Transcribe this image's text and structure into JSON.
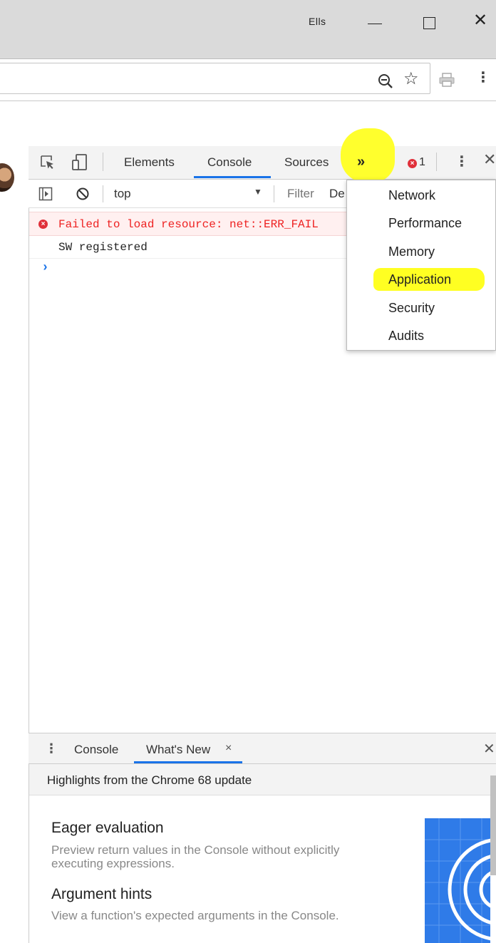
{
  "window": {
    "profile_name": "Ells",
    "minimize_icon": "minimize-icon",
    "maximize_icon": "maximize-icon",
    "close_icon": "close-icon"
  },
  "toolbar": {
    "zoom_icon": "zoom-out-icon",
    "bookmark_icon": "star-icon",
    "extension_icon": "printer-icon",
    "menu_icon": "kebab-menu-icon"
  },
  "devtools": {
    "tabs": [
      {
        "label": "Elements"
      },
      {
        "label": "Console",
        "active": true
      },
      {
        "label": "Sources"
      }
    ],
    "more_tabs_glyph": "»",
    "error_count": "1",
    "context": "top",
    "filter_placeholder": "Filter",
    "levels_label": "De",
    "overflow_menu": {
      "items": [
        {
          "label": "Network"
        },
        {
          "label": "Performance"
        },
        {
          "label": "Memory"
        },
        {
          "label": "Application",
          "highlighted": true
        },
        {
          "label": "Security"
        },
        {
          "label": "Audits"
        }
      ]
    },
    "messages": [
      {
        "level": "error",
        "text": "Failed to load resource: net::ERR_FAIL"
      },
      {
        "level": "log",
        "text": "SW registered"
      }
    ],
    "prompt_glyph": "›"
  },
  "drawer": {
    "tabs": [
      {
        "label": "Console"
      },
      {
        "label": "What's New",
        "active": true,
        "closable": true
      }
    ],
    "close_glyph": "×",
    "highlights_title": "Highlights from the Chrome 68 update",
    "features": [
      {
        "title": "Eager evaluation",
        "description": "Preview return values in the Console without explicitly executing expressions."
      },
      {
        "title": "Argument hints",
        "description": "View a function's expected arguments in the Console."
      }
    ]
  },
  "colors": {
    "accent": "#1a73e8",
    "highlight": "#ffff22",
    "error": "#ee2222",
    "error_bg": "#fff0f0"
  }
}
